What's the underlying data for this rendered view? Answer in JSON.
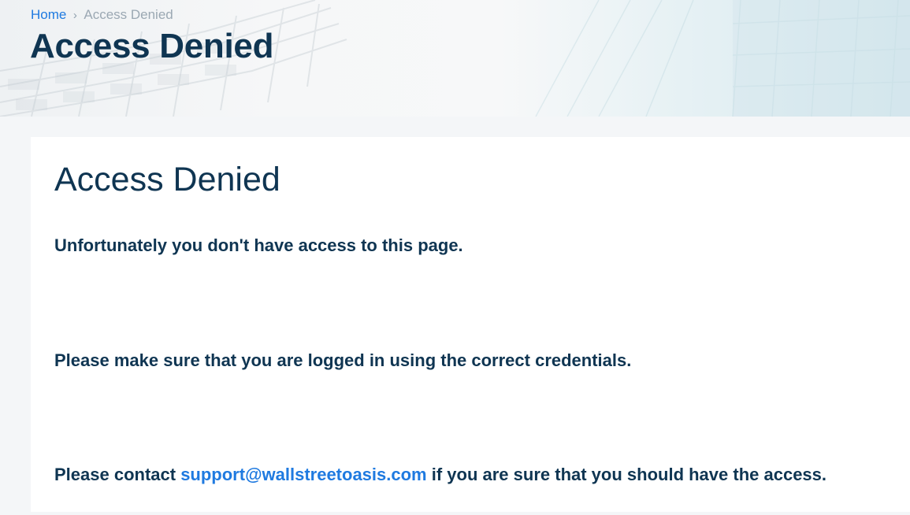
{
  "breadcrumb": {
    "home_label": "Home",
    "separator": "›",
    "current_label": "Access Denied"
  },
  "hero": {
    "title": "Access Denied"
  },
  "content": {
    "title": "Access Denied",
    "message_1": "Unfortunately you don't have access to this page.",
    "message_2": "Please make sure that you are logged in using the correct credentials.",
    "message_3_prefix": "Please contact ",
    "support_email": "support@wallstreetoasis.com",
    "message_3_suffix": " if you are sure that you should have the access."
  },
  "colors": {
    "title_navy": "#0f3552",
    "link_blue": "#1f7ae0",
    "page_bg": "#f4f6f8",
    "card_bg": "#ffffff"
  }
}
